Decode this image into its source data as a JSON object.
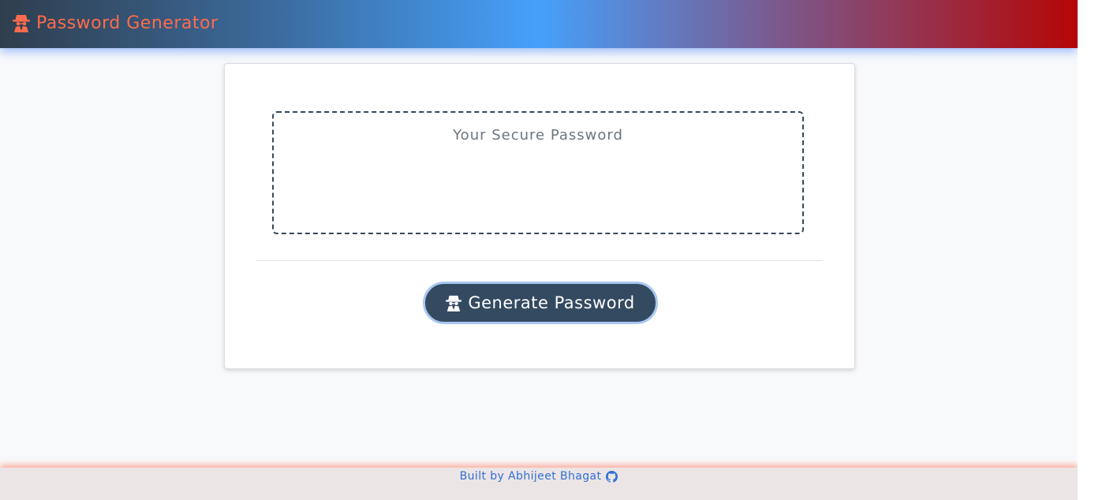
{
  "app": {
    "title": "Password Generator",
    "brand_icon": "spy-icon",
    "brand_color": "#ff6b4d"
  },
  "password_output": {
    "placeholder": "Your Secure Password",
    "value": ""
  },
  "generate_button": {
    "label": "Generate Password",
    "icon": "spy-icon",
    "color": "#344a61"
  },
  "footer": {
    "credit": "Built by Abhijeet Bhagat",
    "icon": "github-icon",
    "color": "#2f6fd6"
  }
}
